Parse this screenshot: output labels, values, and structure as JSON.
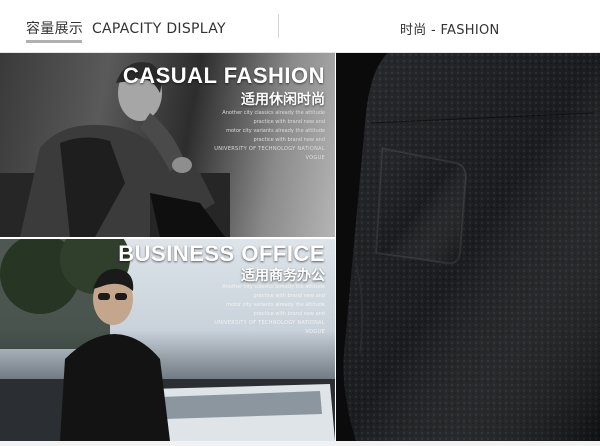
{
  "header": {
    "left_cn": "容量展示",
    "left_en": "CAPACITY DISPLAY",
    "right_label": "时尚 - FASHION"
  },
  "casual": {
    "title_en": "CASUAL FASHION",
    "title_cn": "适用休闲时尚",
    "blurb": [
      "Another city classics already the attitude",
      "practice with brand new and",
      "motor city variants already the attitude",
      "practice with brand new and",
      "UNIVERSITY OF TECHNOLOGY NATIONAL VOGUE"
    ]
  },
  "business": {
    "title_en": "BUSINESS OFFICE",
    "title_cn": "适用商务办公",
    "blurb": [
      "Another city classics already the attitude",
      "practice with brand new and",
      "motor city variants already the attitude",
      "practice with brand new and",
      "UNIVERSITY OF TECHNOLOGY NATIONAL VOGUE"
    ]
  },
  "colors": {
    "wallet_leather": "#141518",
    "text_dark": "#333333"
  }
}
